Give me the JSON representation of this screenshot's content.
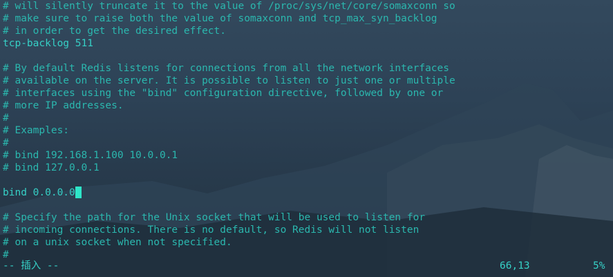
{
  "buffer": {
    "lines": [
      "# will silently truncate it to the value of /proc/sys/net/core/somaxconn so",
      "# make sure to raise both the value of somaxconn and tcp_max_syn_backlog",
      "# in order to get the desired effect.",
      "tcp-backlog 511",
      "",
      "# By default Redis listens for connections from all the network interfaces",
      "# available on the server. It is possible to listen to just one or multiple",
      "# interfaces using the \"bind\" configuration directive, followed by one or",
      "# more IP addresses.",
      "#",
      "# Examples:",
      "#",
      "# bind 192.168.1.100 10.0.0.1",
      "# bind 127.0.0.1",
      "",
      "bind 0.0.0.0",
      "",
      "# Specify the path for the Unix socket that will be used to listen for",
      "# incoming connections. There is no default, so Redis will not listen",
      "# on a unix socket when not specified.",
      "#"
    ]
  },
  "statusline": {
    "mode": "-- 插入 --",
    "position": "66,13",
    "percent": "5%"
  },
  "colors": {
    "text": "#2bb7ae",
    "cursor": "#2ee6c8"
  }
}
